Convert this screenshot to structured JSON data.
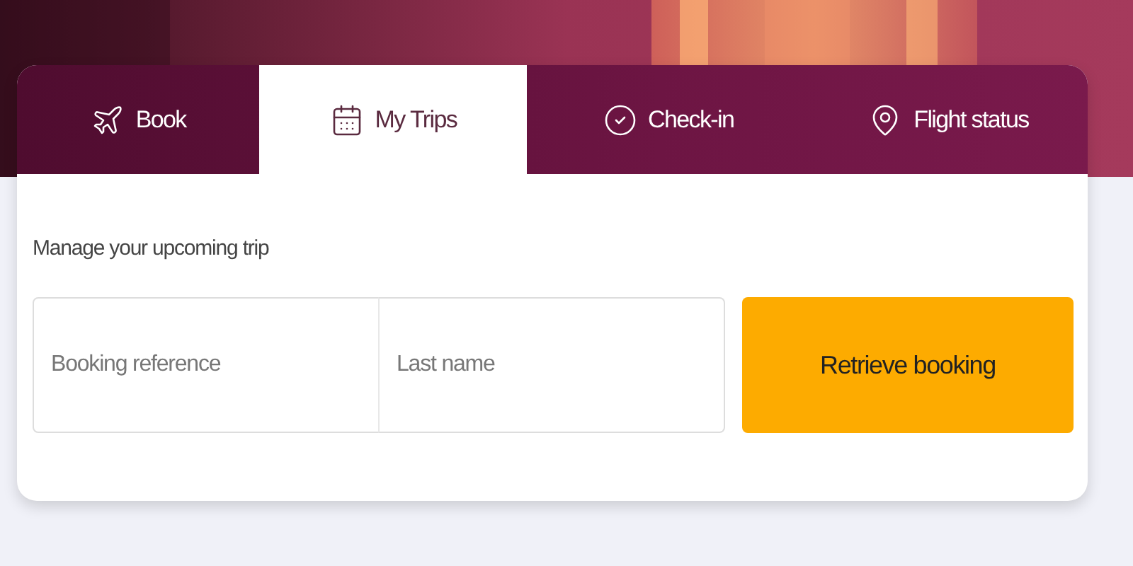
{
  "tabs": [
    {
      "label": "Book",
      "selected": false
    },
    {
      "label": "My Trips",
      "selected": true
    },
    {
      "label": "Check-in",
      "selected": false
    },
    {
      "label": "Flight status",
      "selected": false
    }
  ],
  "panel": {
    "heading": "Manage your upcoming trip",
    "fields": [
      {
        "placeholder": "Booking reference"
      },
      {
        "placeholder": "Last name"
      }
    ],
    "button": "Retrieve booking"
  }
}
